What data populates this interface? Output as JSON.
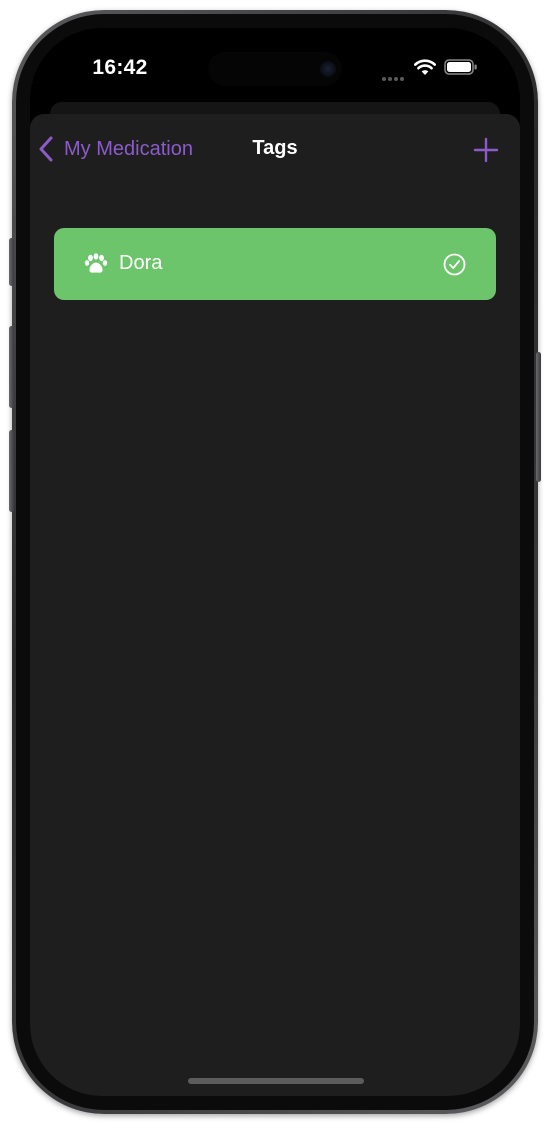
{
  "status_bar": {
    "time": "16:42",
    "icons": [
      "signal-dots-icon",
      "wifi-icon",
      "battery-icon"
    ]
  },
  "nav": {
    "back_label": "My Medication",
    "title": "Tags",
    "add_icon": "plus-icon",
    "back_icon": "chevron-left-icon"
  },
  "tags": [
    {
      "label": "Dora",
      "icon": "paw-icon",
      "selected": true,
      "selected_icon": "checkmark-circle-icon",
      "color": "#6cc46b"
    }
  ],
  "colors": {
    "accent": "#8b5cc9",
    "background": "#1e1e1e",
    "tag_green": "#6cc46b"
  }
}
